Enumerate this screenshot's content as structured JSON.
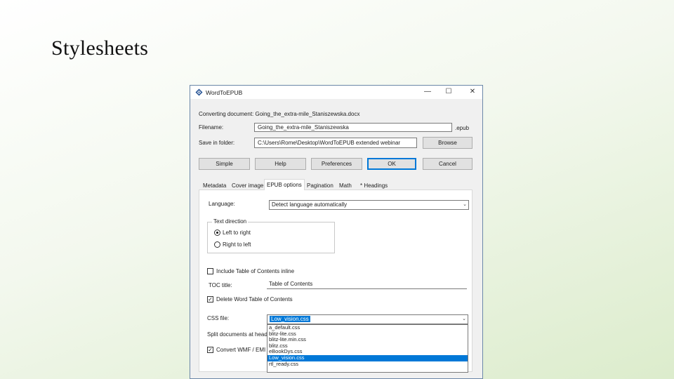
{
  "slide": {
    "title": "Stylesheets"
  },
  "window": {
    "title": "WordToEPUB",
    "controls": {
      "minimize": "—",
      "maximize": "☐",
      "close": "✕"
    },
    "converting_label": "Converting document: Going_the_extra-mile_Staniszewska.docx",
    "filename_label": "Filename:",
    "filename_value": "Going_the_extra-mile_Staniszewska",
    "filename_ext": ".epub",
    "folder_label": "Save in folder:",
    "folder_value": "C:\\Users\\Rome\\Desktop\\WordToEPUB extended webinar",
    "browse_label": "Browse",
    "buttons": {
      "simple": "Simple",
      "help": "Help",
      "preferences": "Preferences",
      "ok": "OK",
      "cancel": "Cancel"
    },
    "tabs": [
      "Metadata",
      "Cover image",
      "EPUB options",
      "Pagination",
      "Math",
      "* Headings"
    ],
    "language_label": "Language:",
    "language_value": "Detect language automatically",
    "text_direction": {
      "title": "Text direction",
      "ltr": "Left to right",
      "rtl": "Right to left"
    },
    "include_toc_label": "Include Table of Contents inline",
    "toc_title_label": "TOC title:",
    "toc_title_value": "Table of Contents",
    "delete_toc_label": "Delete Word Table of Contents",
    "delete_toc_mark": "✓",
    "css_label": "CSS file:",
    "css_value": "Low_vision.css",
    "split_label": "Split documents at headi",
    "convert_label": "Convert WMF / EMI",
    "convert_mark": "✓",
    "css_options": [
      "a_default.css",
      "blitz-lite.css",
      "blitz-lite.min.css",
      "blitz.css",
      "eBookDys.css",
      "Low_vision.css",
      "rtl_ready.css"
    ]
  }
}
